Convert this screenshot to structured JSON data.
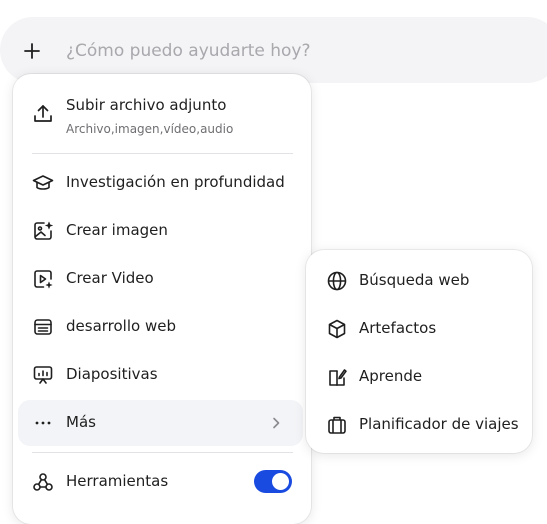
{
  "composer": {
    "placeholder": "¿Cómo puedo ayudarte hoy?"
  },
  "menu": {
    "upload": {
      "label": "Subir archivo adjunto",
      "sublabel": "Archivo,imagen,vídeo,audio",
      "icon": "upload-icon"
    },
    "items": [
      {
        "label": "Investigación en profundidad",
        "icon": "graduation-cap-icon"
      },
      {
        "label": "Crear imagen",
        "icon": "image-sparkle-icon"
      },
      {
        "label": "Crear Video",
        "icon": "video-play-icon"
      },
      {
        "label": "desarrollo web",
        "icon": "web-dev-icon"
      },
      {
        "label": "Diapositivas",
        "icon": "presentation-icon"
      },
      {
        "label": "Más",
        "icon": "more-dots-icon"
      }
    ],
    "tools": {
      "label": "Herramientas",
      "icon": "tools-icon",
      "enabled": true
    }
  },
  "submenu": {
    "items": [
      {
        "label": "Búsqueda web",
        "icon": "globe-icon"
      },
      {
        "label": "Artefactos",
        "icon": "cube-icon"
      },
      {
        "label": "Aprende",
        "icon": "book-edit-icon"
      },
      {
        "label": "Planificador de viajes",
        "icon": "suitcase-icon"
      }
    ]
  },
  "colors": {
    "accent": "#1a4be0",
    "hover": "#f3f4f7",
    "placeholder": "#a8a8ad"
  }
}
